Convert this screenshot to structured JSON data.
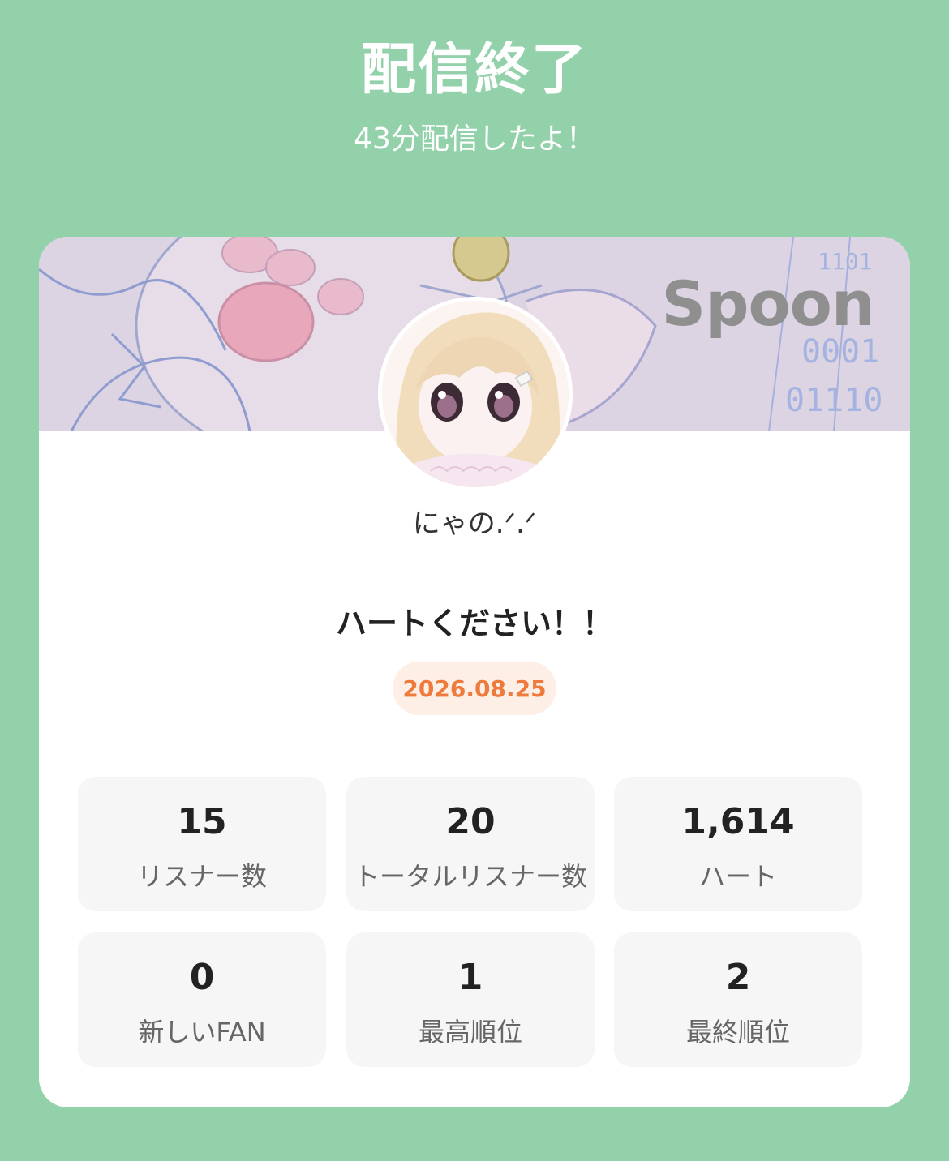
{
  "header": {
    "title": "配信終了",
    "subtitle": "43分配信したよ！"
  },
  "card": {
    "brand": "Spoon",
    "username": "にゃの.ᐟ.ᐟ",
    "stream_title": "ハートください！！",
    "date": "2026.08.25"
  },
  "stats": [
    {
      "value": "15",
      "label": "リスナー数"
    },
    {
      "value": "20",
      "label": "トータルリスナー数"
    },
    {
      "value": "1,614",
      "label": "ハート"
    },
    {
      "value": "0",
      "label": "新しいFAN"
    },
    {
      "value": "1",
      "label": "最高順位"
    },
    {
      "value": "2",
      "label": "最終順位"
    }
  ],
  "colors": {
    "background": "#93d1aa",
    "date_accent": "#ee7a3c",
    "date_badge_bg": "#fdeee6"
  }
}
